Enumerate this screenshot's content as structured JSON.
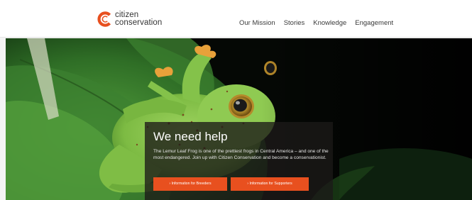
{
  "brand": {
    "line1": "citizen",
    "line2": "conservation",
    "accent_color": "#e8501f"
  },
  "nav": {
    "items": [
      "Our Mission",
      "Stories",
      "Knowledge",
      "Engagement"
    ]
  },
  "hero": {
    "title": "We need help",
    "body": "The Lemur Leaf Frog is one of the prettiest frogs in Central America – and one of the most endangered. Join up with Citizen Conservation and become a conservationist.",
    "button_breeders": "› Information for Breeders",
    "button_supporters": "› Information for Supporters",
    "button_color": "#e8501f"
  }
}
